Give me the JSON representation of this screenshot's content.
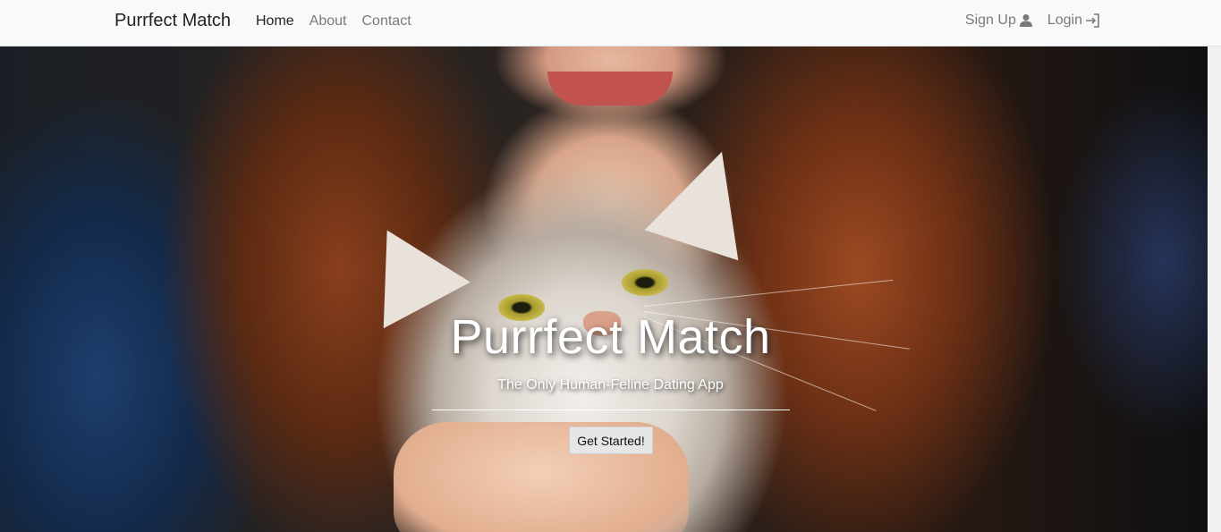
{
  "navbar": {
    "brand": "Purrfect Match",
    "links": [
      {
        "label": "Home",
        "active": true
      },
      {
        "label": "About",
        "active": false
      },
      {
        "label": "Contact",
        "active": false
      }
    ],
    "right": [
      {
        "label": "Sign Up",
        "icon": "user-icon"
      },
      {
        "label": "Login",
        "icon": "login-icon"
      }
    ]
  },
  "hero": {
    "title": "Purrfect Match",
    "subtitle": "The Only Human-Feline Dating App",
    "cta_label": "Get Started!"
  },
  "colors": {
    "navbar_bg": "#f8f9fa",
    "button_bg": "#e6e6e6",
    "text_light": "#ffffff"
  }
}
